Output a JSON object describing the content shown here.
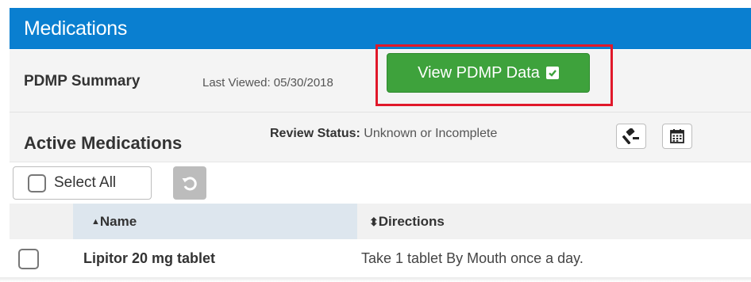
{
  "panel": {
    "title": "Medications"
  },
  "pdmp": {
    "title": "PDMP Summary",
    "last_viewed": "Last Viewed: 05/30/2018",
    "button_label": "View PDMP Data"
  },
  "active": {
    "title": "Active Medications",
    "review_label": "Review Status:",
    "review_value": "Unknown or Incomplete"
  },
  "toolbar": {
    "select_all_label": "Select All"
  },
  "table": {
    "columns": [
      {
        "label": "Name",
        "sort": "ascending"
      },
      {
        "label": "Directions",
        "sort": "sortable"
      }
    ],
    "rows": [
      {
        "name": "Lipitor 20 mg tablet",
        "directions": "Take 1 tablet By Mouth once a day."
      }
    ]
  },
  "colors": {
    "header_blue": "#0a7fd0",
    "pdmp_button_green": "#3ea23c",
    "highlight_red": "#e0182a"
  }
}
